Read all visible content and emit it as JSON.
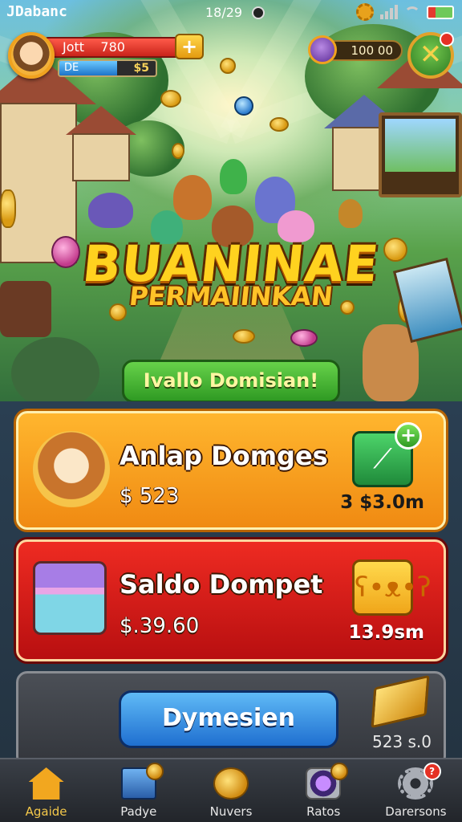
{
  "status_bar": {
    "carrier": "JDabanc",
    "time": "18/29",
    "icons": [
      "settings-icon",
      "signal-icon",
      "wifi-icon",
      "battery-icon"
    ]
  },
  "player": {
    "name": "Jott",
    "level": "780",
    "xp_label": "DE",
    "xp_value": "$5",
    "xp_progress": 0.6
  },
  "currency": {
    "amount": "100 00"
  },
  "banner": {
    "title": "BUANINAE",
    "subtitle": "PERMAIINKAN"
  },
  "action_button": {
    "label": "Ivallo Domisian!"
  },
  "cards": [
    {
      "title": "Anlap Domges",
      "amount": "$ 523",
      "right_value": "3 $3.0m",
      "button_icon": "plus-icon"
    },
    {
      "title": "Saldo Dompet",
      "amount": "$.39.60",
      "right_value": "13.9sm",
      "button_icon": "bear-icon"
    }
  ],
  "panel": {
    "button_label": "Dymesien",
    "value": "523 s.0"
  },
  "nav": [
    {
      "label": "Agaide",
      "icon": "home-icon",
      "active": true
    },
    {
      "label": "Padye",
      "icon": "news-icon"
    },
    {
      "label": "Nuvers",
      "icon": "coins-icon"
    },
    {
      "label": "Ratos",
      "icon": "orb-icon"
    },
    {
      "label": "Darersons",
      "icon": "gear-icon"
    }
  ],
  "colors": {
    "accent_gold": "#ffd21f",
    "card_orange": "#f08a12",
    "card_red": "#c8151a",
    "primary_blue": "#1f6fd0",
    "action_green": "#2f9a23"
  }
}
